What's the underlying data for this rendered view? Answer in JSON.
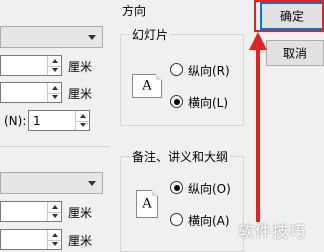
{
  "units": {
    "cm": "厘米"
  },
  "fields": {
    "numbering_label": "(N):",
    "numbering_value": "1"
  },
  "orientation": {
    "title": "方向",
    "slides": {
      "label": "幻灯片",
      "portrait": "纵向(R)",
      "landscape": "横向(L)",
      "selected": "横向(L)"
    },
    "notes": {
      "label": "备注、讲义和大纲",
      "portrait": "纵向(O)",
      "landscape": "横向(A)",
      "selected": "纵向(O)"
    },
    "page_glyph": "A"
  },
  "buttons": {
    "ok": "确定",
    "cancel": "取消"
  },
  "annotation": {
    "color": "#e02424"
  },
  "watermark": "软件技巧"
}
